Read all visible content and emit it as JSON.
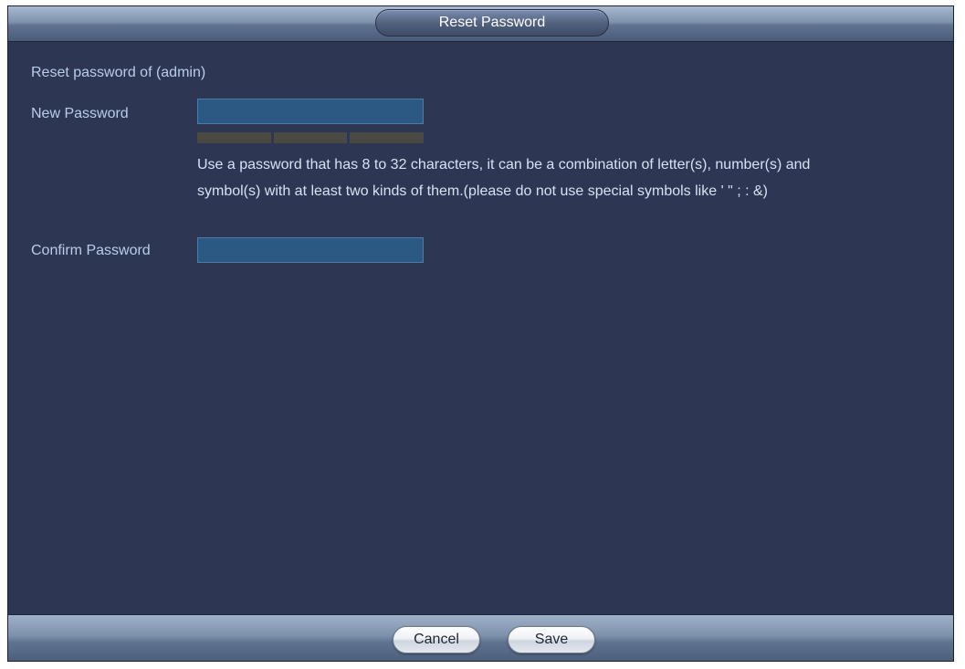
{
  "window": {
    "title": "Reset Password"
  },
  "form": {
    "heading": "Reset password of (admin)",
    "new_password_label": "New Password",
    "new_password_value": "",
    "strength_segments": 3,
    "hint": "Use a password that has 8 to 32 characters, it can be a combination of letter(s), number(s) and symbol(s) with at least two kinds of them.(please do not use special symbols like ' \" ; : &)",
    "confirm_password_label": "Confirm Password",
    "confirm_password_value": ""
  },
  "footer": {
    "cancel_label": "Cancel",
    "save_label": "Save"
  },
  "colors": {
    "background": "#2d3652",
    "input_fill": "#2c5884",
    "strength_empty": "#4b4a42",
    "label_text": "#b9cdea"
  }
}
